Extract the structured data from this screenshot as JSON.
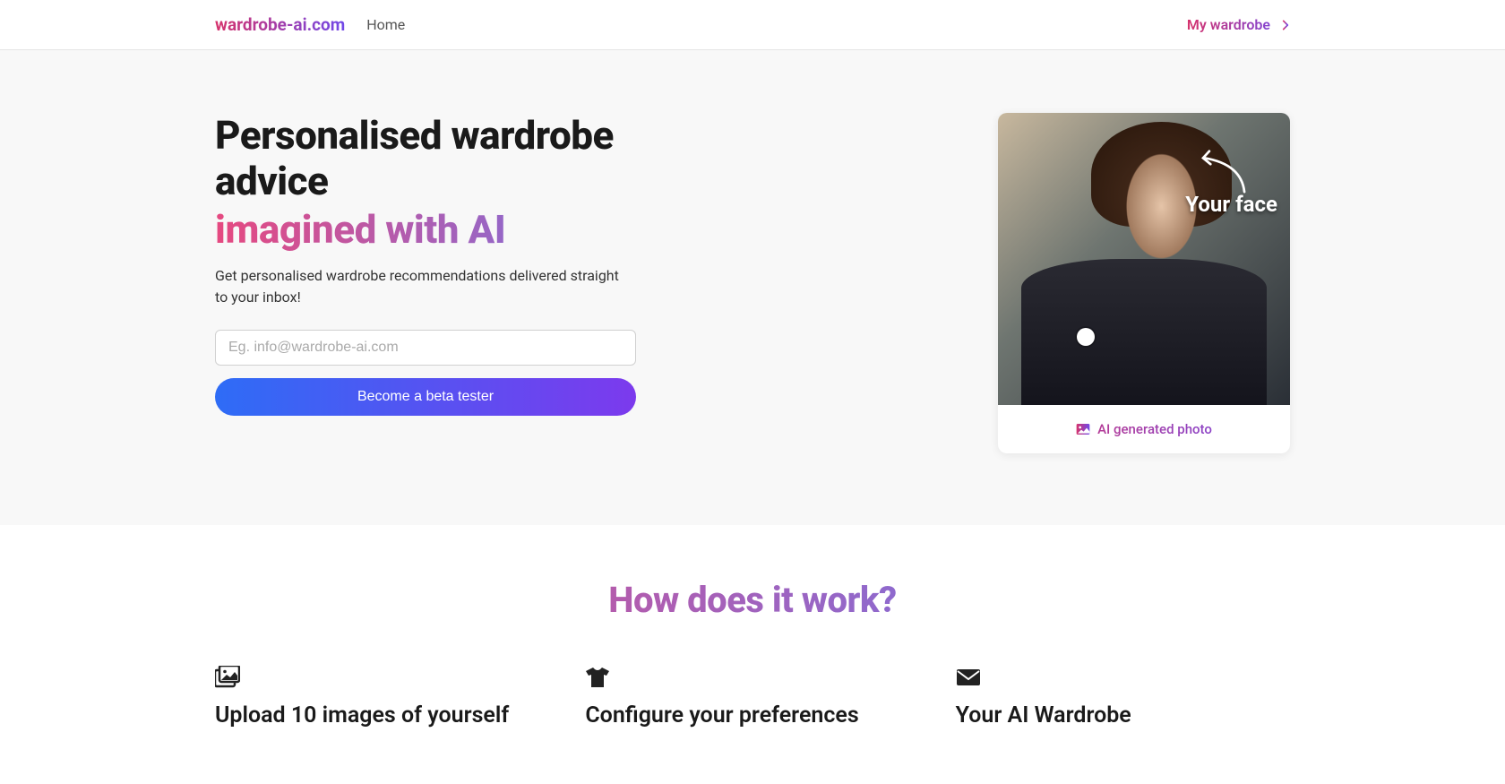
{
  "header": {
    "logo": "wardrobe-ai.com",
    "nav_home": "Home",
    "wardrobe_link": "My wardrobe"
  },
  "hero": {
    "title_main": "Personalised wardrobe advice",
    "title_accent": "imagined with AI",
    "subtitle": "Get personalised wardrobe recommendations delivered straight to your inbox!",
    "email_placeholder": "Eg. info@wardrobe-ai.com",
    "cta_label": "Become a beta tester",
    "photo_overlay_label": "Your face",
    "photo_caption": "AI generated photo"
  },
  "how": {
    "title": "How does it work?",
    "features": [
      {
        "title": "Upload 10 images of yourself"
      },
      {
        "title": "Configure your preferences"
      },
      {
        "title": "Your AI Wardrobe"
      }
    ]
  }
}
